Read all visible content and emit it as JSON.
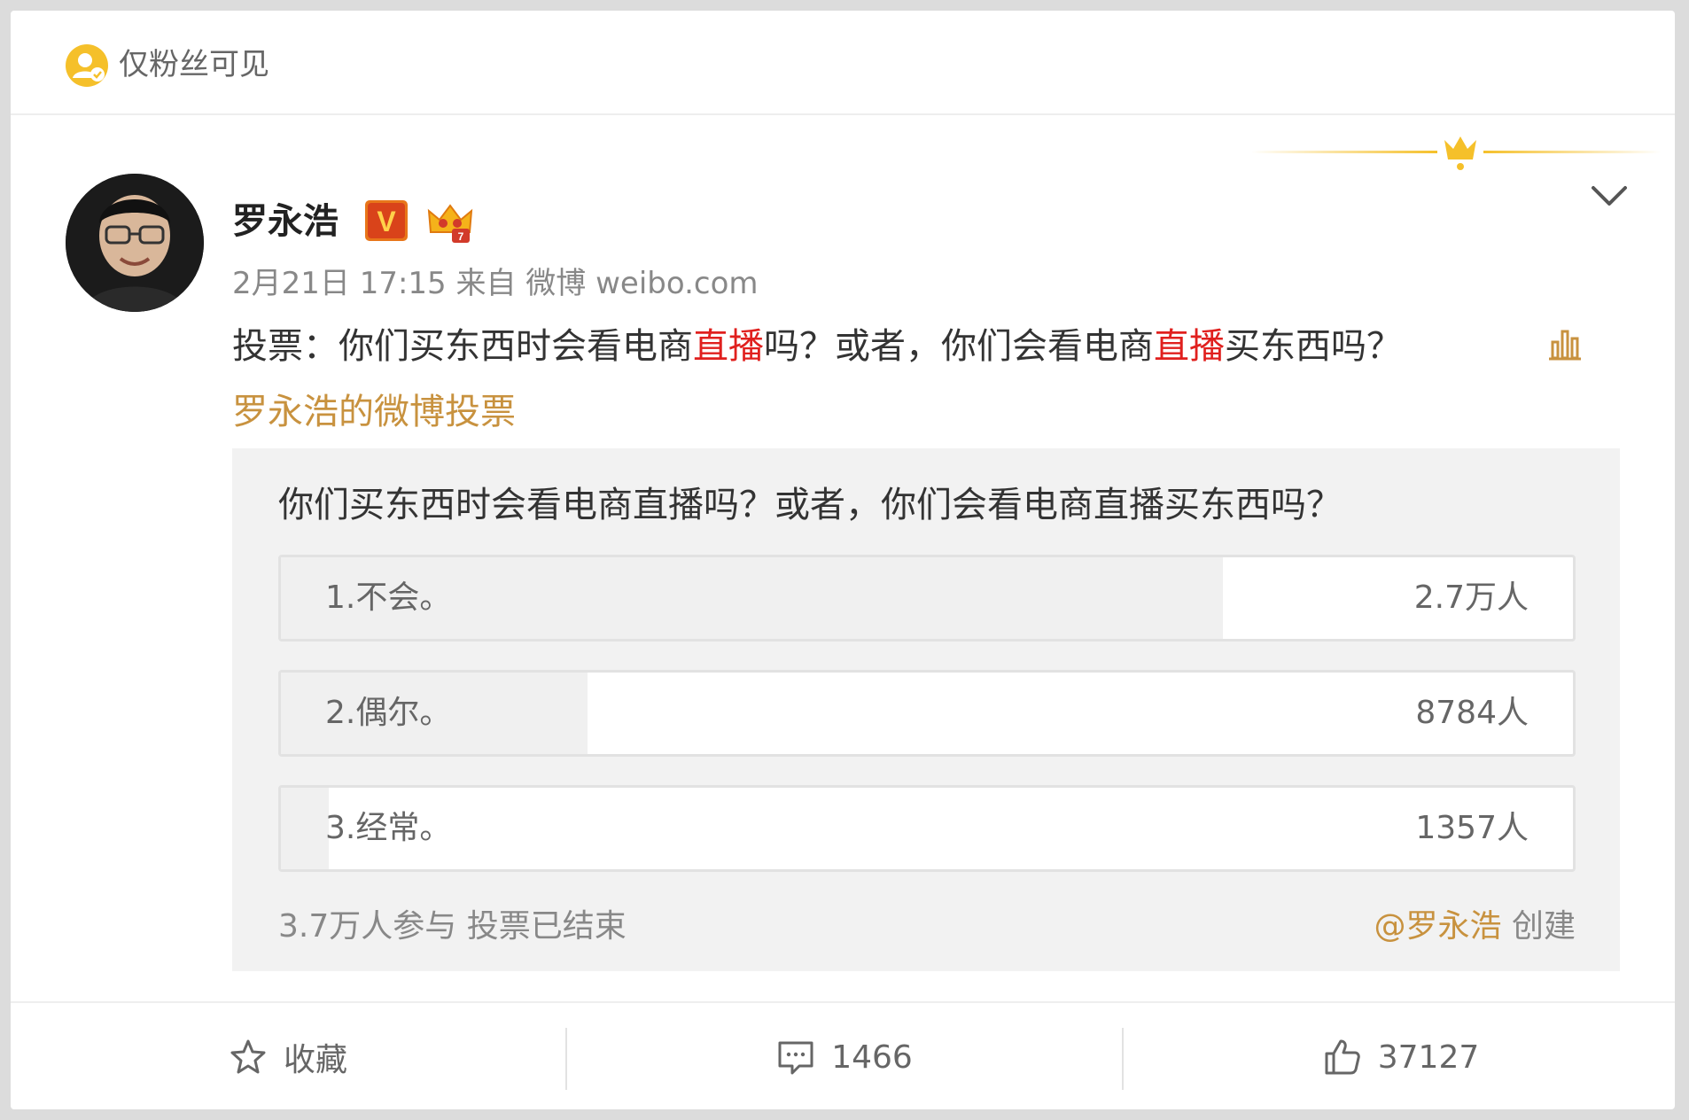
{
  "visibility": {
    "text": "仅粉丝可见"
  },
  "user": {
    "name": "罗永浩",
    "verified_letter": "V"
  },
  "post": {
    "meta": "2月21日 17:15 来自 微博 weibo.com",
    "text_parts": [
      "投票：你们买东西时会看电商",
      "直播",
      "吗？或者，你们会看电商",
      "直播",
      "买东西吗？"
    ],
    "vote_link": "罗永浩的微博投票"
  },
  "poll": {
    "question": "你们买东西时会看电商直播吗？或者，你们会看电商直播买东西吗？",
    "options": [
      {
        "label": "1.不会。",
        "count": "2.7万人",
        "share": 0.729
      },
      {
        "label": "2.偶尔。",
        "count": "8784人",
        "share": 0.237
      },
      {
        "label": "3.经常。",
        "count": "1357人",
        "share": 0.037
      }
    ],
    "footer": "3.7万人参与 投票已结束",
    "creator_at": "@罗永浩",
    "creator_suffix": " 创建"
  },
  "actions": {
    "favorite": "收藏",
    "comments": "1466",
    "likes": "37127"
  },
  "colors": {
    "accent": "#c8923f",
    "highlight": "#e0201e",
    "crown": "#f5c02a"
  }
}
